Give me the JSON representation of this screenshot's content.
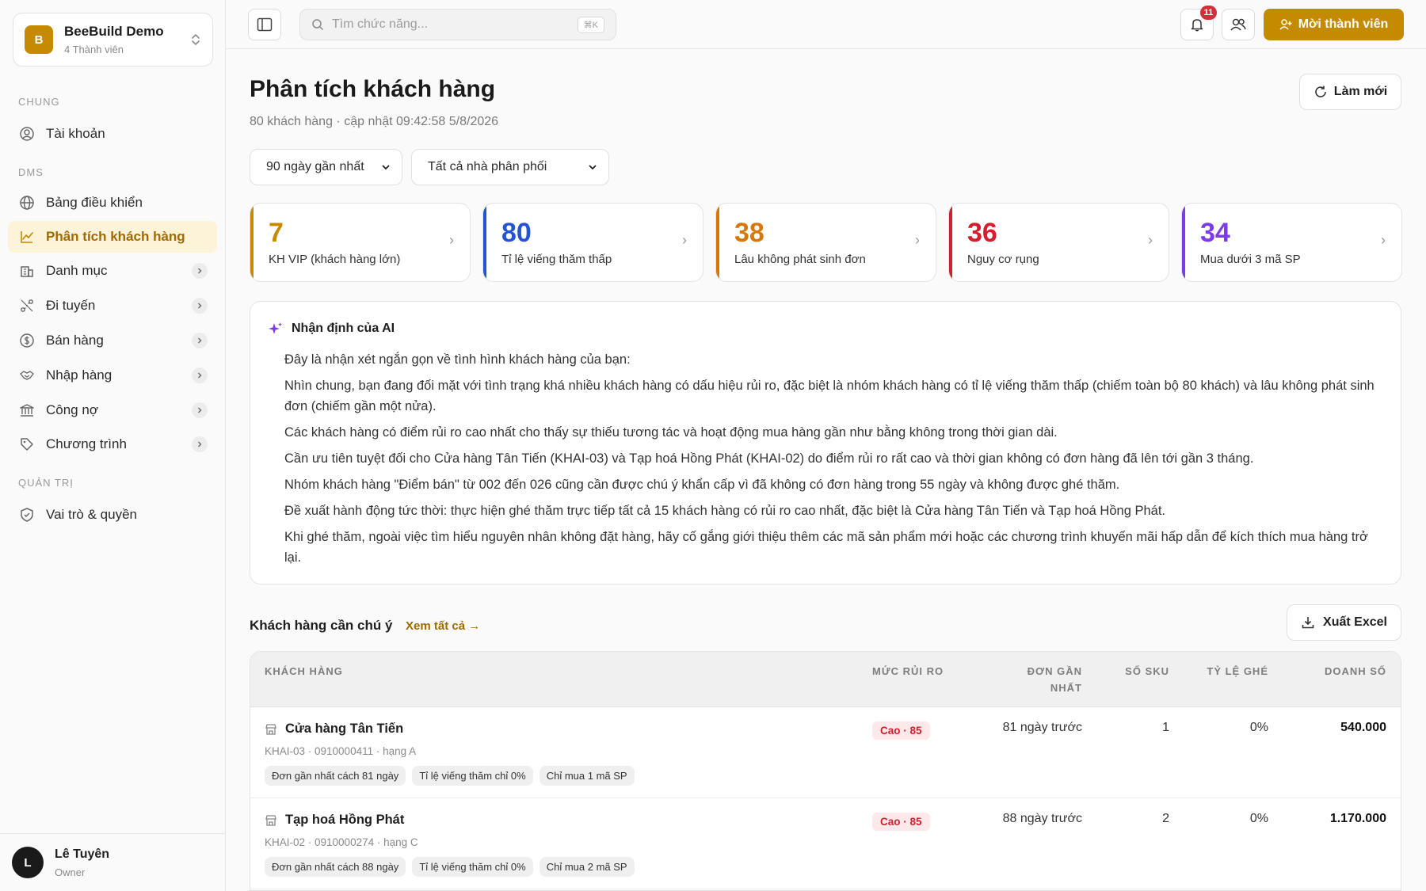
{
  "org": {
    "initial": "B",
    "name": "BeeBuild Demo",
    "members": "4 Thành viên"
  },
  "sidebar": {
    "sections": [
      "CHUNG",
      "DMS",
      "QUẢN TRỊ"
    ],
    "items": [
      {
        "label": "Tài khoản"
      },
      {
        "label": "Bảng điều khiển"
      },
      {
        "label": "Phân tích khách hàng"
      },
      {
        "label": "Danh mục"
      },
      {
        "label": "Đi tuyến"
      },
      {
        "label": "Bán hàng"
      },
      {
        "label": "Nhập hàng"
      },
      {
        "label": "Công nợ"
      },
      {
        "label": "Chương trình"
      },
      {
        "label": "Vai trò & quyền"
      }
    ]
  },
  "user": {
    "initial": "L",
    "name": "Lê Tuyên",
    "role": "Owner"
  },
  "topbar": {
    "search_placeholder": "Tìm chức năng...",
    "shortcut": "⌘K",
    "notifications": "11",
    "invite_label": "Mời thành viên"
  },
  "page": {
    "title": "Phân tích khách hàng",
    "subtitle": "80 khách hàng · cập nhật 09:42:58 5/8/2026",
    "refresh_label": "Làm mới",
    "filter_period": "90 ngày gần nhất",
    "filter_distributor": "Tất cả nhà phân phối"
  },
  "kpis": [
    {
      "value": "7",
      "label": "KH VIP (khách hàng lớn)",
      "color": "#c48a00"
    },
    {
      "value": "80",
      "label": "Tỉ lệ viếng thăm thấp",
      "color": "#2453d6"
    },
    {
      "value": "38",
      "label": "Lâu không phát sinh đơn",
      "color": "#d97706"
    },
    {
      "value": "36",
      "label": "Nguy cơ rụng",
      "color": "#d21f2e"
    },
    {
      "value": "34",
      "label": "Mua dưới 3 mã SP",
      "color": "#7c3aed"
    }
  ],
  "ai": {
    "title": "Nhận định của AI",
    "lines": [
      "Đây là nhận xét ngắn gọn về tình hình khách hàng của bạn:",
      "Nhìn chung, bạn đang đối mặt với tình trạng khá nhiều khách hàng có dấu hiệu rủi ro, đặc biệt là nhóm khách hàng có tỉ lệ viếng thăm thấp (chiếm toàn bộ 80 khách) và lâu không phát sinh đơn (chiếm gần một nửa).",
      "Các khách hàng có điểm rủi ro cao nhất cho thấy sự thiếu tương tác và hoạt động mua hàng gần như bằng không trong thời gian dài.",
      "Cần ưu tiên tuyệt đối cho Cửa hàng Tân Tiến (KHAI-03) và Tạp hoá Hồng Phát (KHAI-02) do điểm rủi ro rất cao và thời gian không có đơn hàng đã lên tới gần 3 tháng.",
      "Nhóm khách hàng \"Điểm bán\" từ 002 đến 026 cũng cần được chú ý khẩn cấp vì đã không có đơn hàng trong 55 ngày và không được ghé thăm.",
      "Đề xuất hành động tức thời: thực hiện ghé thăm trực tiếp tất cả 15 khách hàng có rủi ro cao nhất, đặc biệt là Cửa hàng Tân Tiến và Tạp hoá Hồng Phát.",
      "Khi ghé thăm, ngoài việc tìm hiểu nguyên nhân không đặt hàng, hãy cố gắng giới thiệu thêm các mã sản phẩm mới hoặc các chương trình khuyến mãi hấp dẫn để kích thích mua hàng trở lại."
    ]
  },
  "attention": {
    "title": "Khách hàng cần chú ý",
    "view_all": "Xem tất cả →",
    "export_label": "Xuất Excel",
    "columns": [
      "KHÁCH HÀNG",
      "MỨC RỦI RO",
      "ĐƠN GẦN",
      "NHẤT",
      "SỐ SKU",
      "TỶ LỆ GHÉ",
      "DOANH SỐ"
    ],
    "rows": [
      {
        "name": "Cửa hàng Tân Tiến",
        "meta": "KHAI-03 · 0910000411 · hạng A",
        "tags": [
          "Đơn gần nhất cách 81 ngày",
          "Tỉ lệ viếng thăm chỉ 0%",
          "Chỉ mua 1 mã SP"
        ],
        "risk": "Cao · 85",
        "last_order": "81 ngày trước",
        "sku": "1",
        "visit_rate": "0%",
        "revenue": "540.000"
      },
      {
        "name": "Tạp hoá Hồng Phát",
        "meta": "KHAI-02 · 0910000274 · hạng C",
        "tags": [
          "Đơn gần nhất cách 88 ngày",
          "Tỉ lệ viếng thăm chỉ 0%",
          "Chỉ mua 2 mã SP"
        ],
        "risk": "Cao · 85",
        "last_order": "88 ngày trước",
        "sku": "2",
        "visit_rate": "0%",
        "revenue": "1.170.000"
      }
    ]
  }
}
